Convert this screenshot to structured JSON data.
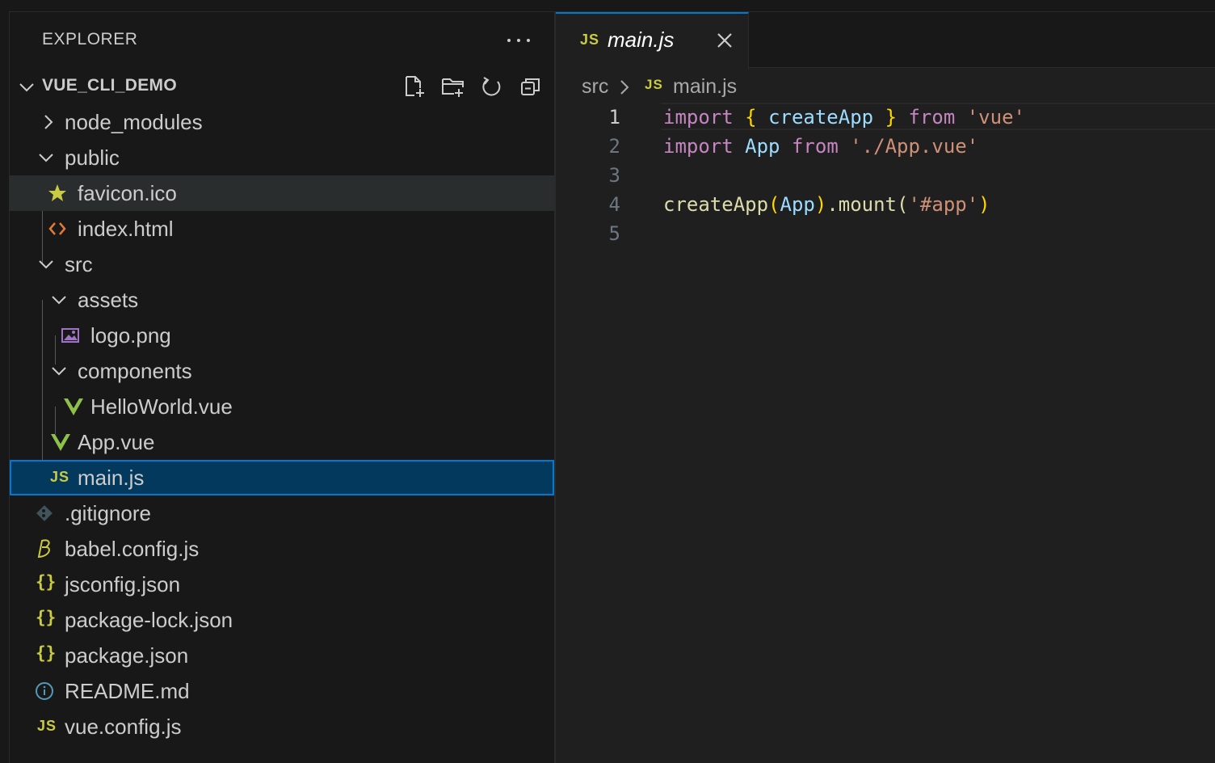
{
  "sidebar": {
    "header": "EXPLORER",
    "project": "VUE_CLI_DEMO",
    "tree": [
      {
        "label": "node_modules",
        "kind": "folder",
        "expanded": false,
        "icon": "chevron-right-icon"
      },
      {
        "label": "public",
        "kind": "folder",
        "expanded": true,
        "icon": "chevron-down-icon"
      },
      {
        "label": "favicon.ico",
        "kind": "file",
        "icon": "star-icon"
      },
      {
        "label": "index.html",
        "kind": "file",
        "icon": "html-icon"
      },
      {
        "label": "src",
        "kind": "folder",
        "expanded": true,
        "icon": "chevron-down-icon"
      },
      {
        "label": "assets",
        "kind": "folder",
        "expanded": true,
        "icon": "chevron-down-icon"
      },
      {
        "label": "logo.png",
        "kind": "file",
        "icon": "image-icon"
      },
      {
        "label": "components",
        "kind": "folder",
        "expanded": true,
        "icon": "chevron-down-icon"
      },
      {
        "label": "HelloWorld.vue",
        "kind": "file",
        "icon": "vue-icon"
      },
      {
        "label": "App.vue",
        "kind": "file",
        "icon": "vue-icon"
      },
      {
        "label": "main.js",
        "kind": "file",
        "icon": "js-icon"
      },
      {
        "label": ".gitignore",
        "kind": "file",
        "icon": "git-icon"
      },
      {
        "label": "babel.config.js",
        "kind": "file",
        "icon": "babel-icon"
      },
      {
        "label": "jsconfig.json",
        "kind": "file",
        "icon": "json-icon"
      },
      {
        "label": "package-lock.json",
        "kind": "file",
        "icon": "json-icon"
      },
      {
        "label": "package.json",
        "kind": "file",
        "icon": "json-icon"
      },
      {
        "label": "README.md",
        "kind": "file",
        "icon": "info-icon"
      },
      {
        "label": "vue.config.js",
        "kind": "file",
        "icon": "js-icon"
      }
    ]
  },
  "editor": {
    "tab": {
      "icon_text": "JS",
      "label": "main.js"
    },
    "breadcrumb": {
      "folder": "src",
      "icon_text": "JS",
      "file": "main.js"
    },
    "line_numbers": [
      "1",
      "2",
      "3",
      "4",
      "5"
    ],
    "lines": [
      {
        "t1": "import",
        "t2": "{",
        "t3": "createApp",
        "t4": "}",
        "t5": "from",
        "t6": "'vue'"
      },
      {
        "t1": "import",
        "t2": "App",
        "t3": "from",
        "t4": "'./App.vue'"
      },
      {},
      {
        "t1": "createApp",
        "t2": "(",
        "t3": "App",
        "t4": ")",
        "t5": ".mount(",
        "t6": "'#app'",
        "t7": ")"
      },
      {}
    ]
  },
  "colors": {
    "accent": "#0078d4",
    "selection": "#04395e",
    "js_yellow": "#cbcb41",
    "vue_green": "#8dc149",
    "html_orange": "#e37933"
  }
}
